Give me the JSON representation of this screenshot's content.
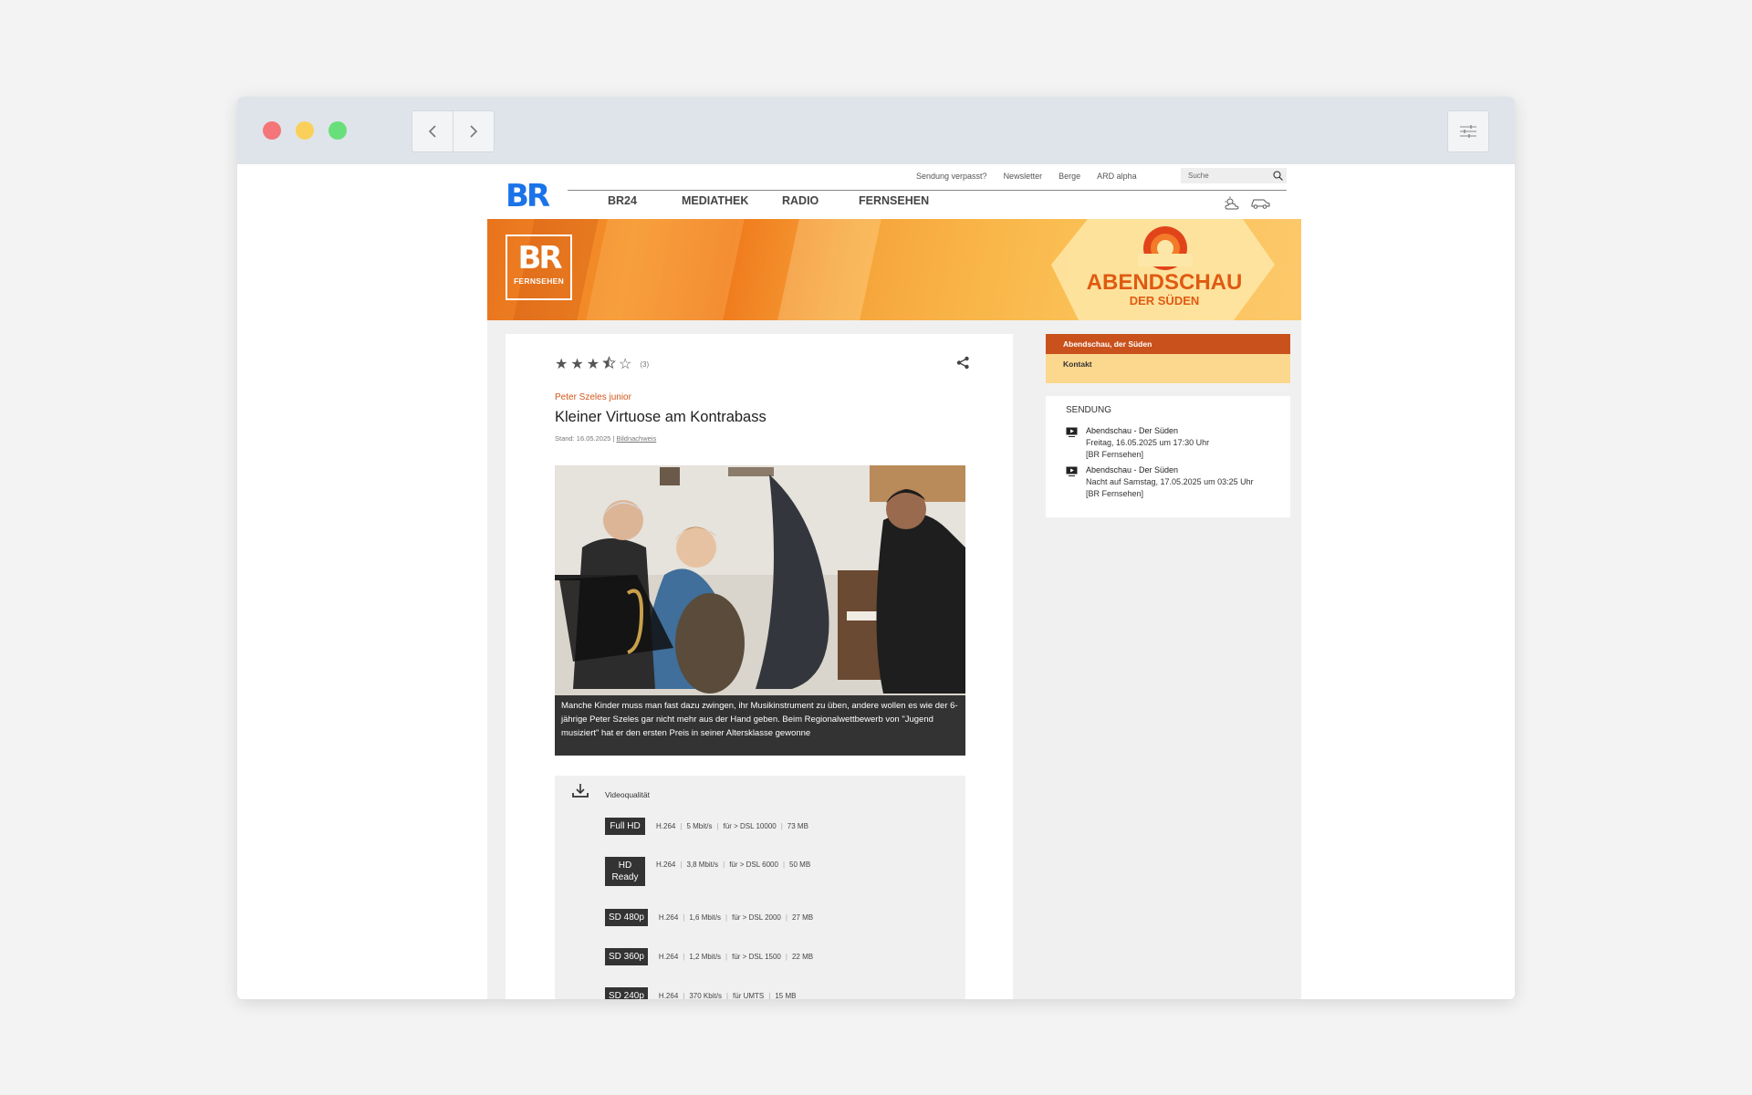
{
  "browser": {
    "back_icon": "chevron-left-icon",
    "forward_icon": "chevron-right-icon",
    "settings_icon": "sliders-icon"
  },
  "header": {
    "logo_text": "BR",
    "util_links": [
      "Sendung verpasst?",
      "Newsletter",
      "Berge",
      "ARD alpha"
    ],
    "search_placeholder": "Suche",
    "nav": [
      "BR24",
      "MEDIATHEK",
      "RADIO",
      "FERNSEHEN"
    ],
    "weather_icon": "weather-icon",
    "traffic_icon": "car-icon"
  },
  "banner": {
    "logo_big": "BR",
    "logo_small": "FERNSEHEN",
    "show_title": "ABENDSCHAU",
    "show_sub": "DER SÜDEN"
  },
  "article": {
    "rating_value": 3.5,
    "rating_max": 5,
    "rating_count": "(3)",
    "kicker": "Peter Szeles junior",
    "headline": "Kleiner Virtuose am Kontrabass",
    "meta_date": "Stand: 16.05.2025 |",
    "meta_link": "Bildnachweis",
    "caption": "Manche Kinder muss man fast dazu zwingen, ihr Musikinstrument zu üben, andere wollen es wie der 6-jährige Peter Szeles gar nicht mehr aus der Hand geben. Beim Regionalwettbewerb von \"Jugend musiziert\" hat er den ersten Preis in seiner Altersklasse gewonne"
  },
  "downloads": {
    "label": "Videoqualität",
    "rows": [
      {
        "badge": "Full HD",
        "codec": "H.264",
        "rate": "5 Mbit/s",
        "dsl": "für > DSL 10000",
        "size": "73 MB"
      },
      {
        "badge": "HD Ready",
        "codec": "H.264",
        "rate": "3,8 Mbit/s",
        "dsl": "für > DSL 6000",
        "size": "50 MB"
      },
      {
        "badge": "SD 480p",
        "codec": "H.264",
        "rate": "1,6 Mbit/s",
        "dsl": "für > DSL 2000",
        "size": "27 MB"
      },
      {
        "badge": "SD 360p",
        "codec": "H.264",
        "rate": "1,2 Mbit/s",
        "dsl": "für > DSL 1500",
        "size": "22 MB"
      },
      {
        "badge": "SD 240p",
        "codec": "H.264",
        "rate": "370 Kbit/s",
        "dsl": "für UMTS",
        "size": "15 MB"
      }
    ]
  },
  "sidebar": {
    "top": "Abendschau, der Süden",
    "sub": "Kontakt",
    "heading": "SENDUNG",
    "entries": [
      {
        "title": "Abendschau - Der Süden",
        "when": "Freitag, 16.05.2025 um 17:30 Uhr",
        "channel": "[BR Fernsehen]"
      },
      {
        "title": "Abendschau - Der Süden",
        "when": "Nacht auf Samstag, 17.05.2025 um 03:25 Uhr",
        "channel": "[BR Fernsehen]"
      }
    ]
  },
  "colors": {
    "accent": "#c9521c",
    "kicker": "#d2561a",
    "br_blue": "#1a73e8"
  }
}
